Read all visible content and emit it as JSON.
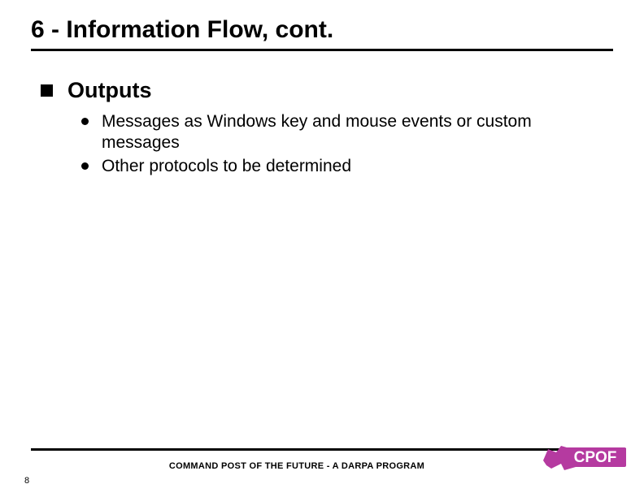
{
  "title": "6 - Information Flow, cont.",
  "content": {
    "heading": "Outputs",
    "items": [
      "Messages as Windows key and mouse events or custom messages",
      "Other protocols to be determined"
    ]
  },
  "footer": {
    "page": "8",
    "text": "COMMAND POST OF THE FUTURE - A DARPA PROGRAM",
    "logo_text": "CPOF"
  }
}
